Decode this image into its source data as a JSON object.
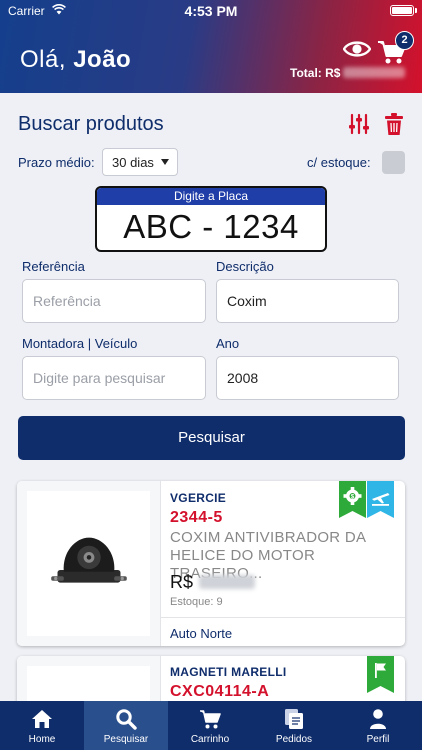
{
  "status": {
    "carrier": "Carrier",
    "time": "4:53 PM"
  },
  "header": {
    "greeting_prefix": "Olá,",
    "user_name": "João",
    "cart_count": "2",
    "total_label": "Total: R$",
    "brand_gradient": [
      "#143f8c",
      "#d4112c"
    ]
  },
  "search": {
    "title": "Buscar produtos",
    "prazo_label": "Prazo médio:",
    "prazo_value": "30 dias",
    "estoque_label": "c/ estoque:",
    "estoque_checked": false,
    "plate_label": "Digite a Placa",
    "plate_value": "ABC - 1234",
    "referencia_label": "Referência",
    "referencia_placeholder": "Referência",
    "referencia_value": "",
    "descricao_label": "Descrição",
    "descricao_value": "Coxim",
    "montadora_label": "Montadora | Veículo",
    "montadora_placeholder": "Digite para pesquisar",
    "ano_label": "Ano",
    "ano_value": "2008",
    "button_label": "Pesquisar"
  },
  "products": [
    {
      "brand": "VGERCIE",
      "code": "2344-5",
      "description_line1": "COXIM ANTIVIBRADOR DA",
      "description_line2": "HELICE DO MOTOR TRASEIRO...",
      "price_label": "R$",
      "stock": "Estoque: 9",
      "store": "Auto Norte",
      "badges": [
        "gear-badge-icon",
        "plane-badge-icon"
      ]
    },
    {
      "brand": "MAGNETI MARELLI",
      "code": "CXC04114-A",
      "badges": [
        "flag-badge-icon"
      ]
    }
  ],
  "tabs": [
    {
      "label": "Home",
      "icon": "home-icon"
    },
    {
      "label": "Pesquisar",
      "icon": "search-icon",
      "active": true
    },
    {
      "label": "Carrinho",
      "icon": "cart-icon"
    },
    {
      "label": "Pedidos",
      "icon": "orders-icon"
    },
    {
      "label": "Perfil",
      "icon": "profile-icon"
    }
  ],
  "colors": {
    "navy": "#0f2d6b",
    "red": "#d4112c",
    "green_badge": "#2eaa3a",
    "blue_badge": "#2fb6e6"
  }
}
